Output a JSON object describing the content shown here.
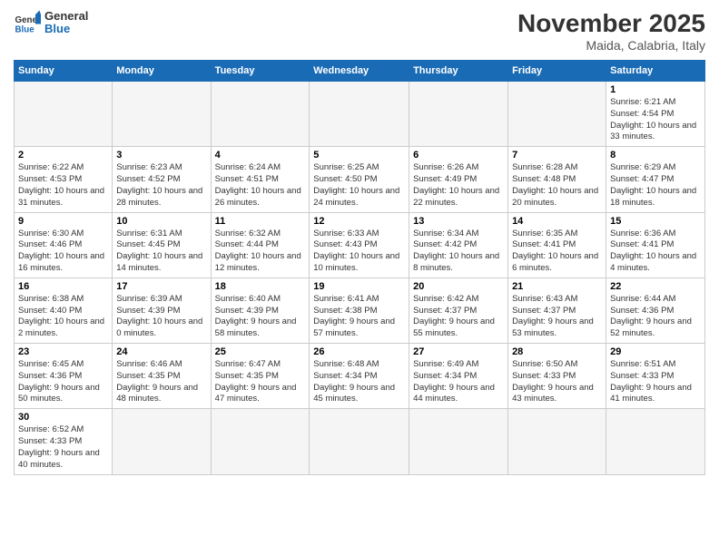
{
  "header": {
    "logo_general": "General",
    "logo_blue": "Blue",
    "month_title": "November 2025",
    "location": "Maida, Calabria, Italy"
  },
  "weekdays": [
    "Sunday",
    "Monday",
    "Tuesday",
    "Wednesday",
    "Thursday",
    "Friday",
    "Saturday"
  ],
  "days": [
    {
      "num": "",
      "info": ""
    },
    {
      "num": "",
      "info": ""
    },
    {
      "num": "",
      "info": ""
    },
    {
      "num": "",
      "info": ""
    },
    {
      "num": "",
      "info": ""
    },
    {
      "num": "",
      "info": ""
    },
    {
      "num": "1",
      "info": "Sunrise: 6:21 AM\nSunset: 4:54 PM\nDaylight: 10 hours and 33 minutes."
    },
    {
      "num": "2",
      "info": "Sunrise: 6:22 AM\nSunset: 4:53 PM\nDaylight: 10 hours and 31 minutes."
    },
    {
      "num": "3",
      "info": "Sunrise: 6:23 AM\nSunset: 4:52 PM\nDaylight: 10 hours and 28 minutes."
    },
    {
      "num": "4",
      "info": "Sunrise: 6:24 AM\nSunset: 4:51 PM\nDaylight: 10 hours and 26 minutes."
    },
    {
      "num": "5",
      "info": "Sunrise: 6:25 AM\nSunset: 4:50 PM\nDaylight: 10 hours and 24 minutes."
    },
    {
      "num": "6",
      "info": "Sunrise: 6:26 AM\nSunset: 4:49 PM\nDaylight: 10 hours and 22 minutes."
    },
    {
      "num": "7",
      "info": "Sunrise: 6:28 AM\nSunset: 4:48 PM\nDaylight: 10 hours and 20 minutes."
    },
    {
      "num": "8",
      "info": "Sunrise: 6:29 AM\nSunset: 4:47 PM\nDaylight: 10 hours and 18 minutes."
    },
    {
      "num": "9",
      "info": "Sunrise: 6:30 AM\nSunset: 4:46 PM\nDaylight: 10 hours and 16 minutes."
    },
    {
      "num": "10",
      "info": "Sunrise: 6:31 AM\nSunset: 4:45 PM\nDaylight: 10 hours and 14 minutes."
    },
    {
      "num": "11",
      "info": "Sunrise: 6:32 AM\nSunset: 4:44 PM\nDaylight: 10 hours and 12 minutes."
    },
    {
      "num": "12",
      "info": "Sunrise: 6:33 AM\nSunset: 4:43 PM\nDaylight: 10 hours and 10 minutes."
    },
    {
      "num": "13",
      "info": "Sunrise: 6:34 AM\nSunset: 4:42 PM\nDaylight: 10 hours and 8 minutes."
    },
    {
      "num": "14",
      "info": "Sunrise: 6:35 AM\nSunset: 4:41 PM\nDaylight: 10 hours and 6 minutes."
    },
    {
      "num": "15",
      "info": "Sunrise: 6:36 AM\nSunset: 4:41 PM\nDaylight: 10 hours and 4 minutes."
    },
    {
      "num": "16",
      "info": "Sunrise: 6:38 AM\nSunset: 4:40 PM\nDaylight: 10 hours and 2 minutes."
    },
    {
      "num": "17",
      "info": "Sunrise: 6:39 AM\nSunset: 4:39 PM\nDaylight: 10 hours and 0 minutes."
    },
    {
      "num": "18",
      "info": "Sunrise: 6:40 AM\nSunset: 4:39 PM\nDaylight: 9 hours and 58 minutes."
    },
    {
      "num": "19",
      "info": "Sunrise: 6:41 AM\nSunset: 4:38 PM\nDaylight: 9 hours and 57 minutes."
    },
    {
      "num": "20",
      "info": "Sunrise: 6:42 AM\nSunset: 4:37 PM\nDaylight: 9 hours and 55 minutes."
    },
    {
      "num": "21",
      "info": "Sunrise: 6:43 AM\nSunset: 4:37 PM\nDaylight: 9 hours and 53 minutes."
    },
    {
      "num": "22",
      "info": "Sunrise: 6:44 AM\nSunset: 4:36 PM\nDaylight: 9 hours and 52 minutes."
    },
    {
      "num": "23",
      "info": "Sunrise: 6:45 AM\nSunset: 4:36 PM\nDaylight: 9 hours and 50 minutes."
    },
    {
      "num": "24",
      "info": "Sunrise: 6:46 AM\nSunset: 4:35 PM\nDaylight: 9 hours and 48 minutes."
    },
    {
      "num": "25",
      "info": "Sunrise: 6:47 AM\nSunset: 4:35 PM\nDaylight: 9 hours and 47 minutes."
    },
    {
      "num": "26",
      "info": "Sunrise: 6:48 AM\nSunset: 4:34 PM\nDaylight: 9 hours and 45 minutes."
    },
    {
      "num": "27",
      "info": "Sunrise: 6:49 AM\nSunset: 4:34 PM\nDaylight: 9 hours and 44 minutes."
    },
    {
      "num": "28",
      "info": "Sunrise: 6:50 AM\nSunset: 4:33 PM\nDaylight: 9 hours and 43 minutes."
    },
    {
      "num": "29",
      "info": "Sunrise: 6:51 AM\nSunset: 4:33 PM\nDaylight: 9 hours and 41 minutes."
    },
    {
      "num": "30",
      "info": "Sunrise: 6:52 AM\nSunset: 4:33 PM\nDaylight: 9 hours and 40 minutes."
    },
    {
      "num": "",
      "info": ""
    },
    {
      "num": "",
      "info": ""
    },
    {
      "num": "",
      "info": ""
    },
    {
      "num": "",
      "info": ""
    },
    {
      "num": "",
      "info": ""
    }
  ]
}
